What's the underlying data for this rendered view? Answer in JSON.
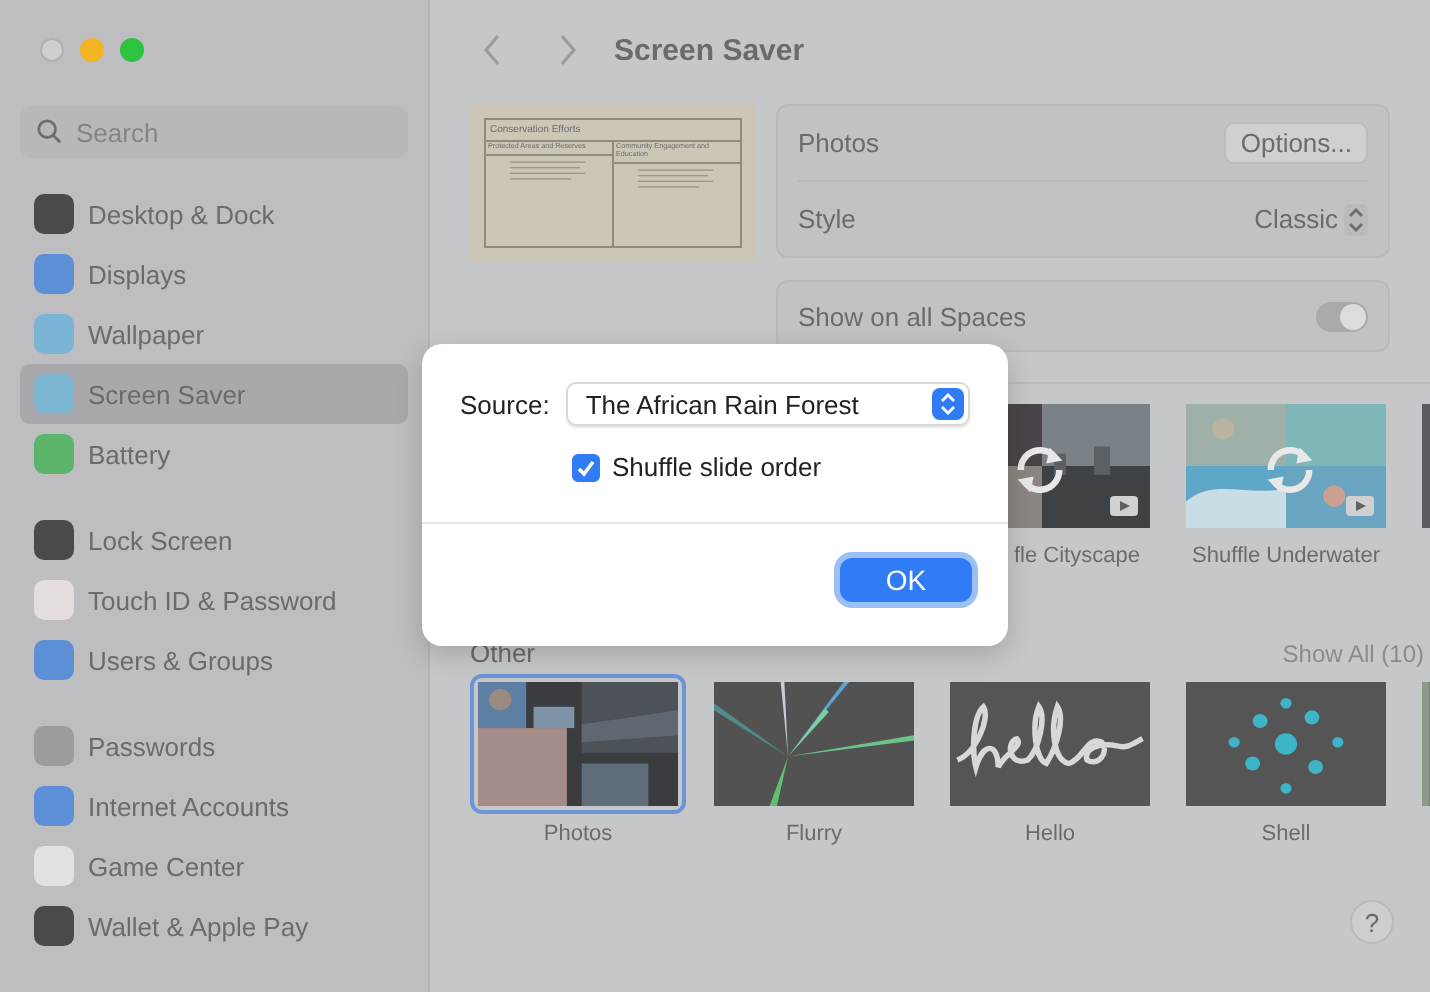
{
  "window": {
    "title": "Screen Saver"
  },
  "sidebar": {
    "search": {
      "placeholder": "Search"
    },
    "groups": [
      [
        {
          "label": "Desktop & Dock",
          "selected": false,
          "color": "#4a4a4c"
        },
        {
          "label": "Displays",
          "selected": false,
          "color": "#5c8fd6"
        },
        {
          "label": "Wallpaper",
          "selected": false,
          "color": "#7cb4d8"
        },
        {
          "label": "Screen Saver",
          "selected": true,
          "color": "#7db6d3"
        },
        {
          "label": "Battery",
          "selected": false,
          "color": "#5bb46a"
        }
      ],
      [
        {
          "label": "Lock Screen",
          "selected": false,
          "color": "#4a4a4c"
        },
        {
          "label": "Touch ID & Password",
          "selected": false,
          "color": "#e4dede"
        },
        {
          "label": "Users & Groups",
          "selected": false,
          "color": "#5c8fd6"
        }
      ],
      [
        {
          "label": "Passwords",
          "selected": false,
          "color": "#9c9c9e"
        },
        {
          "label": "Internet Accounts",
          "selected": false,
          "color": "#5c8fd6"
        },
        {
          "label": "Game Center",
          "selected": false,
          "color": "#e2e0e4"
        },
        {
          "label": "Wallet & Apple Pay",
          "selected": false,
          "color": "#4a4a4c"
        }
      ]
    ]
  },
  "preview": {
    "title": "Conservation Efforts",
    "columns": [
      "Protected Areas and Reserves",
      "Community Engagement and Education"
    ]
  },
  "settings": {
    "photos_label": "Photos",
    "options_button": "Options...",
    "style_label": "Style",
    "style_value": "Classic"
  },
  "spaces": {
    "label": "Show on all Spaces",
    "on": true
  },
  "shuffle": {
    "items": [
      {
        "label": "fle Cityscape",
        "selected": false
      },
      {
        "label": "Shuffle Underwater",
        "selected": false
      }
    ]
  },
  "other": {
    "title": "Other",
    "show_all": "Show All (10)",
    "items": [
      {
        "label": "Photos",
        "selected": true
      },
      {
        "label": "Flurry",
        "selected": false
      },
      {
        "label": "Hello",
        "selected": false
      },
      {
        "label": "Shell",
        "selected": false
      }
    ]
  },
  "help": "?",
  "dialog": {
    "source_label": "Source:",
    "source_value": "The African Rain Forest",
    "shuffle_label": "Shuffle slide order",
    "shuffle_checked": true,
    "ok": "OK"
  }
}
